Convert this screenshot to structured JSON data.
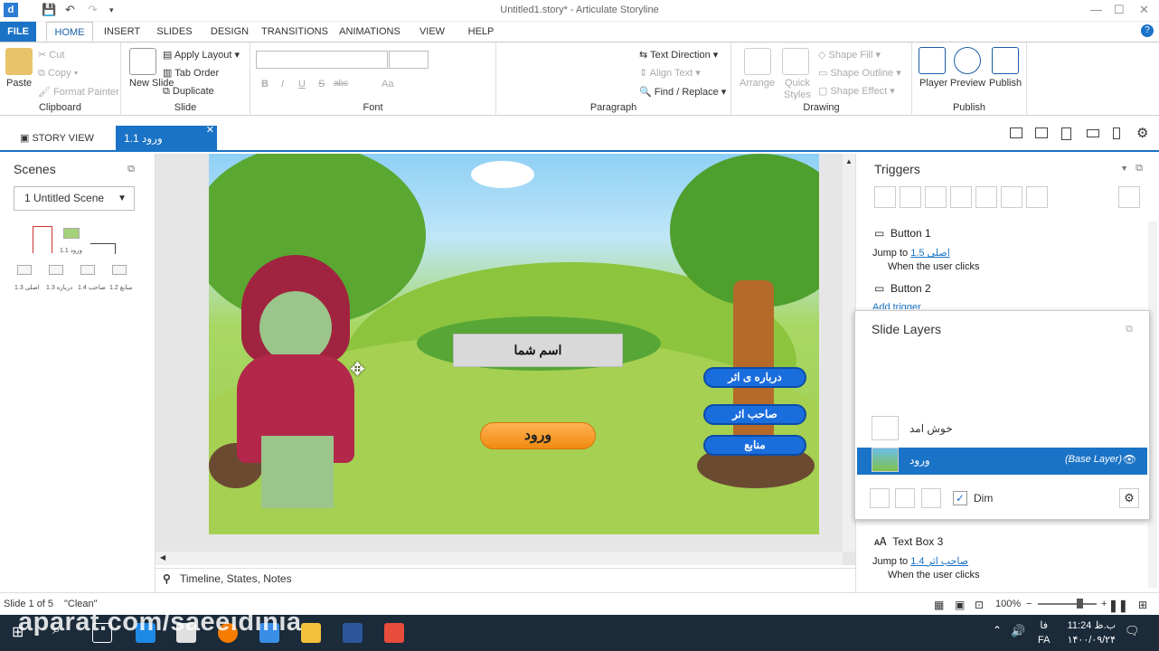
{
  "titlebar": {
    "title": "Untitled1.story* - Articulate Storyline",
    "app_icon": "d"
  },
  "tabs": [
    "FILE",
    "HOME",
    "INSERT",
    "SLIDES",
    "DESIGN",
    "TRANSITIONS",
    "ANIMATIONS",
    "VIEW",
    "HELP"
  ],
  "ribbon": {
    "clipboard": {
      "label": "Clipboard",
      "paste": "Paste",
      "cut": "Cut",
      "copy": "Copy",
      "format_painter": "Format Painter"
    },
    "slide": {
      "label": "Slide",
      "new_slide": "New Slide",
      "apply_layout": "Apply Layout",
      "tab_order": "Tab Order",
      "duplicate": "Duplicate"
    },
    "font": {
      "label": "Font",
      "b": "B",
      "i": "I",
      "u": "U",
      "s": "S",
      "abc": "abc",
      "aa": "Aa"
    },
    "paragraph": {
      "label": "Paragraph",
      "text_direction": "Text Direction",
      "align_text": "Align Text",
      "find_replace": "Find / Replace"
    },
    "drawing": {
      "label": "Drawing",
      "arrange": "Arrange",
      "quick_styles": "Quick Styles",
      "shape_fill": "Shape Fill",
      "shape_outline": "Shape Outline",
      "shape_effect": "Shape Effect"
    },
    "publish": {
      "label": "Publish",
      "player": "Player",
      "preview": "Preview",
      "publish": "Publish"
    }
  },
  "viewtabs": {
    "story_view": "STORY VIEW",
    "slide_tab": "1.1 ورود"
  },
  "scenes": {
    "title": "Scenes",
    "selected": "1 Untitled Scene",
    "thumb_top": "1.1 ورود",
    "thumbs": [
      "1.3 اصلی",
      "1.3 درباره",
      "1.4 صاحب",
      "1.2 منابع"
    ]
  },
  "slide": {
    "name_field": "اسم شما",
    "enter_button": "ورود",
    "about_button": "درباره ی اثر",
    "owner_button": "صاحب اثر",
    "sources_button": "منابع"
  },
  "timeline_label": "Timeline, States, Notes",
  "triggers": {
    "title": "Triggers",
    "items": [
      {
        "name": "Button 1",
        "action": "Jump to",
        "target": "1.5 اصلی",
        "when": "When the user clicks"
      },
      {
        "name": "Button 2",
        "add": "Add trigger"
      },
      {
        "name": "Text Box 3",
        "action": "Jump to",
        "target": "1.4 صاحب اثر",
        "when": "When the user clicks"
      }
    ],
    "partial_when": "When the user clicks"
  },
  "layers": {
    "title": "Slide Layers",
    "layer1": "خوش امد",
    "base_name": "ورود",
    "base_tag": "(Base Layer)",
    "dim": "Dim"
  },
  "status": {
    "slide": "Slide 1 of 5",
    "theme": "\"Clean\"",
    "zoom": "100%"
  },
  "watermark": "aparat.com/saeeidinia",
  "clock": {
    "time": "11:24 ب.ظ",
    "date": "۱۴۰۰/۰۹/۲۴",
    "lang": "FA",
    "lang2": "فا"
  }
}
